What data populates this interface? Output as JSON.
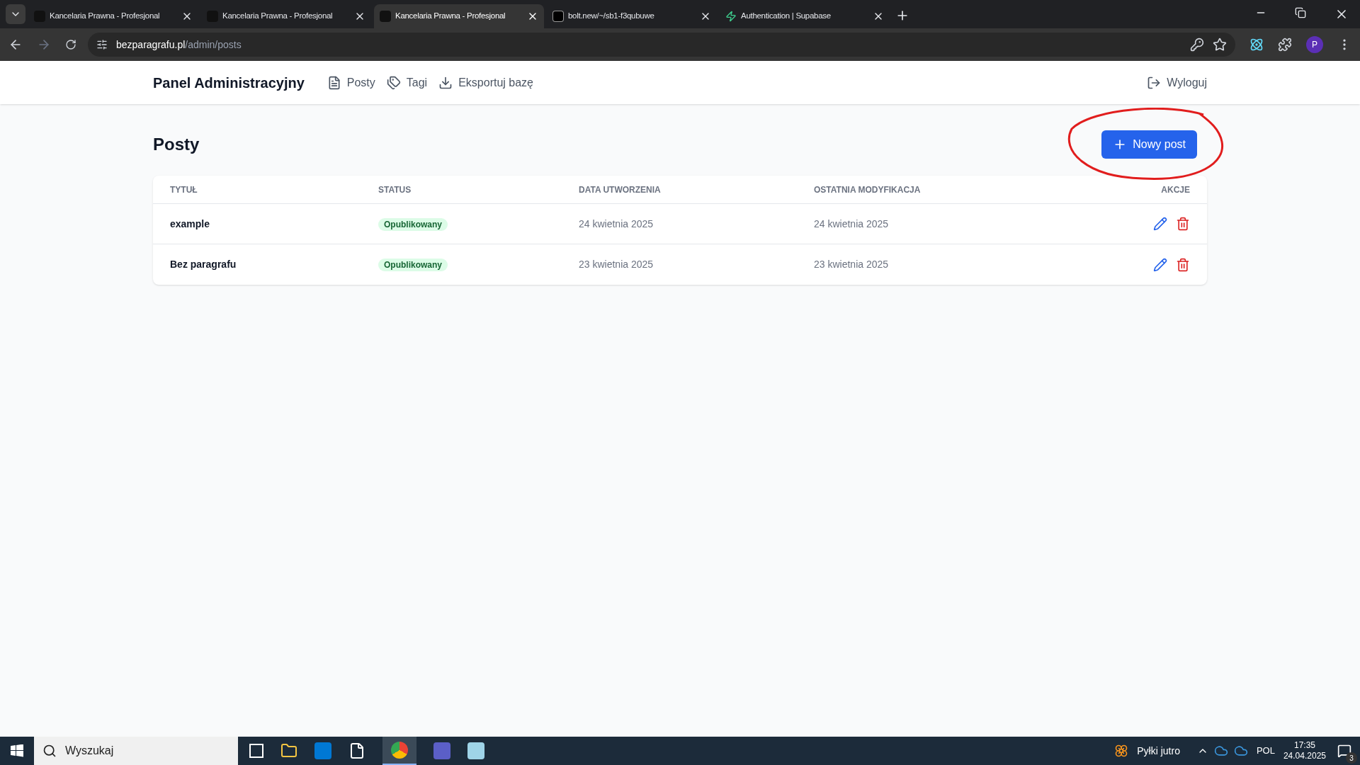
{
  "browser": {
    "tabs": [
      {
        "title": "Kancelaria Prawna - Profesjonal",
        "kind": "site",
        "selected": false
      },
      {
        "title": "Kancelaria Prawna - Profesjonal",
        "kind": "site",
        "selected": false
      },
      {
        "title": "Kancelaria Prawna - Profesjonal",
        "kind": "site",
        "selected": true
      },
      {
        "title": "bolt.new/~/sb1-f3qubuwe",
        "kind": "bolt",
        "selected": false
      },
      {
        "title": "Authentication | Supabase",
        "kind": "supabase",
        "selected": false
      }
    ],
    "url_host": "bezparagrafu.pl",
    "url_path": "/admin/posts",
    "profile": "P"
  },
  "header": {
    "title": "Panel Administracyjny",
    "nav": [
      {
        "label": "Posty",
        "kind": "doc"
      },
      {
        "label": "Tagi",
        "kind": "tags"
      },
      {
        "label": "Eksportuj bazę",
        "kind": "download"
      }
    ],
    "logout": "Wyloguj"
  },
  "page": {
    "title": "Posty",
    "new_button": "Nowy post",
    "annotated": true
  },
  "table": {
    "columns": [
      "TYTUŁ",
      "STATUS",
      "DATA UTWORZENIA",
      "OSTATNIA MODYFIKACJA",
      "AKCJE"
    ],
    "rows": [
      {
        "title": "example",
        "status": "Opublikowany",
        "created": "24 kwietnia 2025",
        "modified": "24 kwietnia 2025"
      },
      {
        "title": "Bez paragrafu",
        "status": "Opublikowany",
        "created": "23 kwietnia 2025",
        "modified": "23 kwietnia 2025"
      }
    ]
  },
  "taskbar": {
    "search": "Wyszukaj",
    "weather": "Pyłki jutro",
    "lang": "POL",
    "time": "17:35",
    "date": "24.04.2025",
    "notifications": "3"
  }
}
